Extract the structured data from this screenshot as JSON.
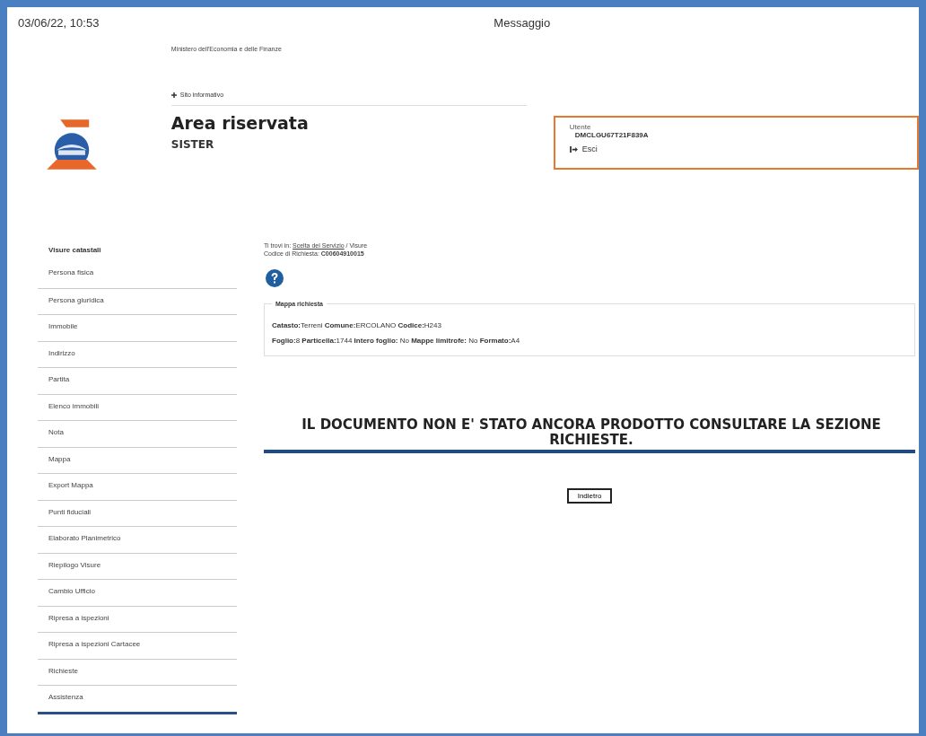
{
  "header": {
    "datetime": "03/06/22, 10:53",
    "title": "Messaggio"
  },
  "ministry": "Ministero dell'Economia e delle Finanze",
  "site_link": "Sito informativo",
  "area_title": "Area riservata",
  "service": "SISTER",
  "user": {
    "label": "Utente",
    "code": "DMCLGU67T21F839A",
    "logout": "Esci"
  },
  "sidebar": {
    "heading": "Visure catastali",
    "items": [
      {
        "label": "Persona fisica"
      },
      {
        "label": "Persona giuridica"
      },
      {
        "label": "Immobile"
      },
      {
        "label": "Indirizzo"
      },
      {
        "label": "Partita"
      },
      {
        "label": "Elenco immobili"
      },
      {
        "label": "Nota"
      },
      {
        "label": "Mappa"
      },
      {
        "label": "Export Mappa"
      },
      {
        "label": "Punti fiduciali"
      },
      {
        "label": "Elaborato Planimetrico"
      },
      {
        "label": "Riepilogo Visure"
      },
      {
        "label": "Cambio Ufficio"
      },
      {
        "label": "Ripresa a ispezioni"
      },
      {
        "label": "Ripresa a ispezioni Cartacee"
      },
      {
        "label": "Richieste"
      },
      {
        "label": "Assistenza"
      }
    ]
  },
  "breadcrumb": {
    "prefix": "Ti trovi in:",
    "link": "Scelta del Servizio",
    "current": "/ Visure"
  },
  "request_code": {
    "label": "Codice di Richiesta:",
    "value": "C00604910015"
  },
  "fieldset": {
    "legend": "Mappa richiesta",
    "lines": [
      "**Catasto:**Terreni **Comune:**ERCOLANO **Codice:**H243",
      "**Foglio:**8 **Particella:**1744 **Intero foglio:** No **Mappe limitrofe:** No **Formato:**A4"
    ]
  },
  "message": "IL DOCUMENTO NON E' STATO ANCORA PRODOTTO CONSULTARE LA SEZIONE RICHIESTE.",
  "back_button": "Indietro"
}
